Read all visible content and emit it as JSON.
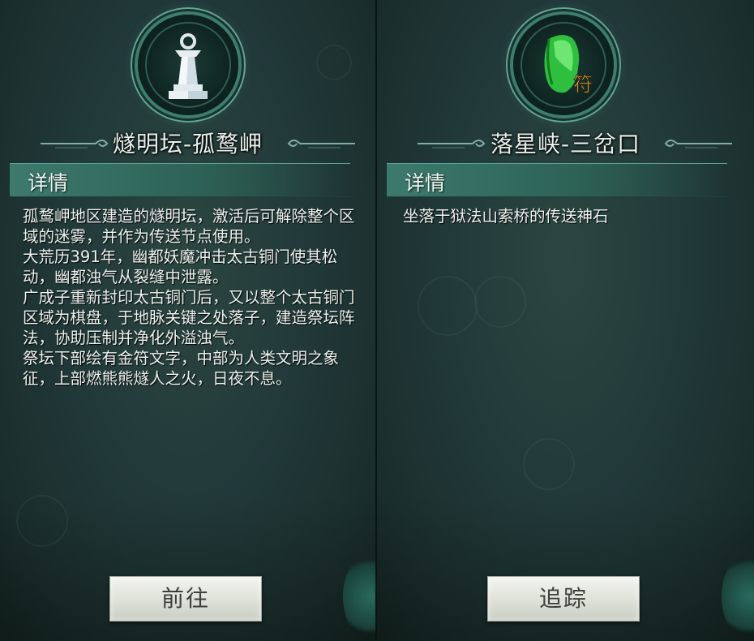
{
  "left_panel": {
    "title": "燧明坛-孤鹜岬",
    "emblem_icon": "altar-pillar-icon",
    "section_label": "详情",
    "description": [
      "孤鹜岬地区建造的燧明坛，激活后可解除整个区域的迷雾，并作为传送节点使用。",
      "大荒历391年，幽都妖魔冲击太古铜门使其松动，幽都浊气从裂缝中泄露。",
      "广成子重新封印太古铜门后，又以整个太古铜门区域为棋盘，于地脉关键之处落子，建造祭坛阵法，协助压制并净化外溢浊气。",
      "祭坛下部绘有金符文字，中部为人类文明之象征，上部燃熊熊燧人之火，日夜不息。"
    ],
    "button_label": "前往"
  },
  "right_panel": {
    "title": "落星峡-三岔口",
    "emblem_icon": "green-teleport-stone-icon",
    "section_label": "详情",
    "description": [
      "坐落于狱法山索桥的传送神石"
    ],
    "button_label": "追踪"
  },
  "colors": {
    "panel_bg": "#22393a",
    "section_bar": "#3d7a6d",
    "emblem_ring": "#5ea595",
    "button_bg": "#dcdfd6",
    "text": "#eef3ef"
  }
}
